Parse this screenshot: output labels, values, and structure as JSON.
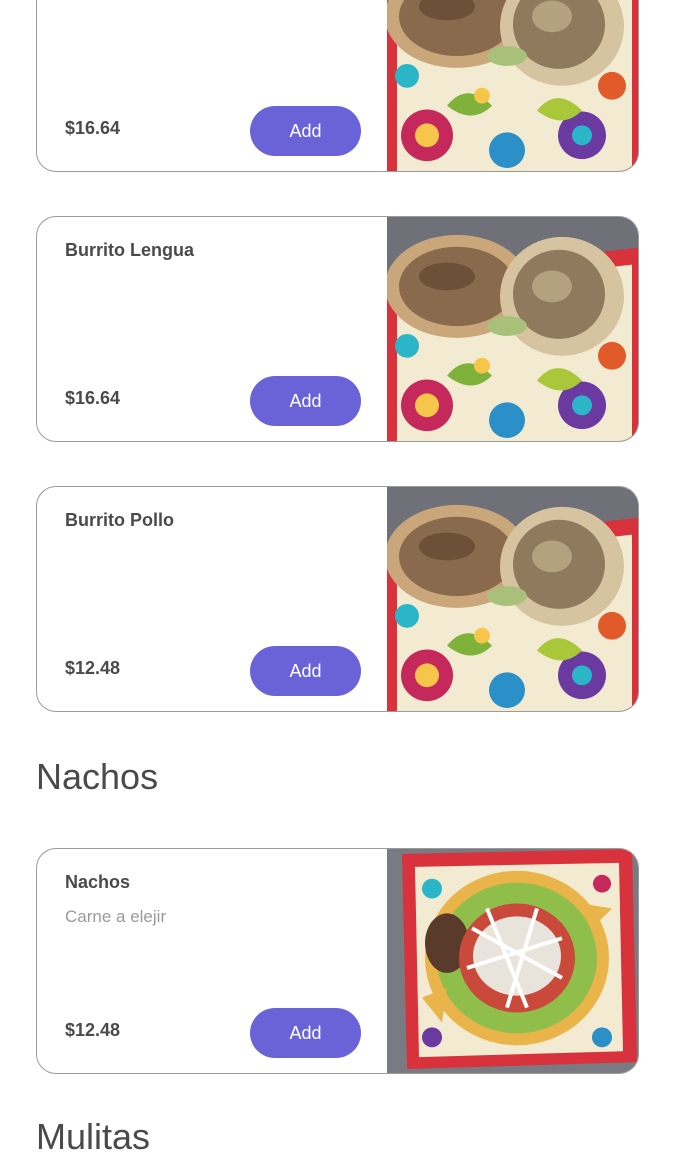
{
  "items": [
    {
      "name": "",
      "description": "",
      "price": "$16.64",
      "add_label": "Add",
      "image": "burrito-photo"
    },
    {
      "name": "Burrito Lengua",
      "description": "",
      "price": "$16.64",
      "add_label": "Add",
      "image": "burrito-photo"
    },
    {
      "name": "Burrito Pollo",
      "description": "",
      "price": "$12.48",
      "add_label": "Add",
      "image": "burrito-photo"
    },
    {
      "name": "Nachos",
      "description": "Carne a elejir",
      "price": "$12.48",
      "add_label": "Add",
      "image": "nachos-photo"
    }
  ],
  "sections": {
    "nachos": "Nachos",
    "mulitas": "Mulitas"
  },
  "colors": {
    "accent": "#6a63d8",
    "text": "#4a4a4a",
    "muted": "#9a9a9a",
    "border": "#9a9a9a"
  }
}
